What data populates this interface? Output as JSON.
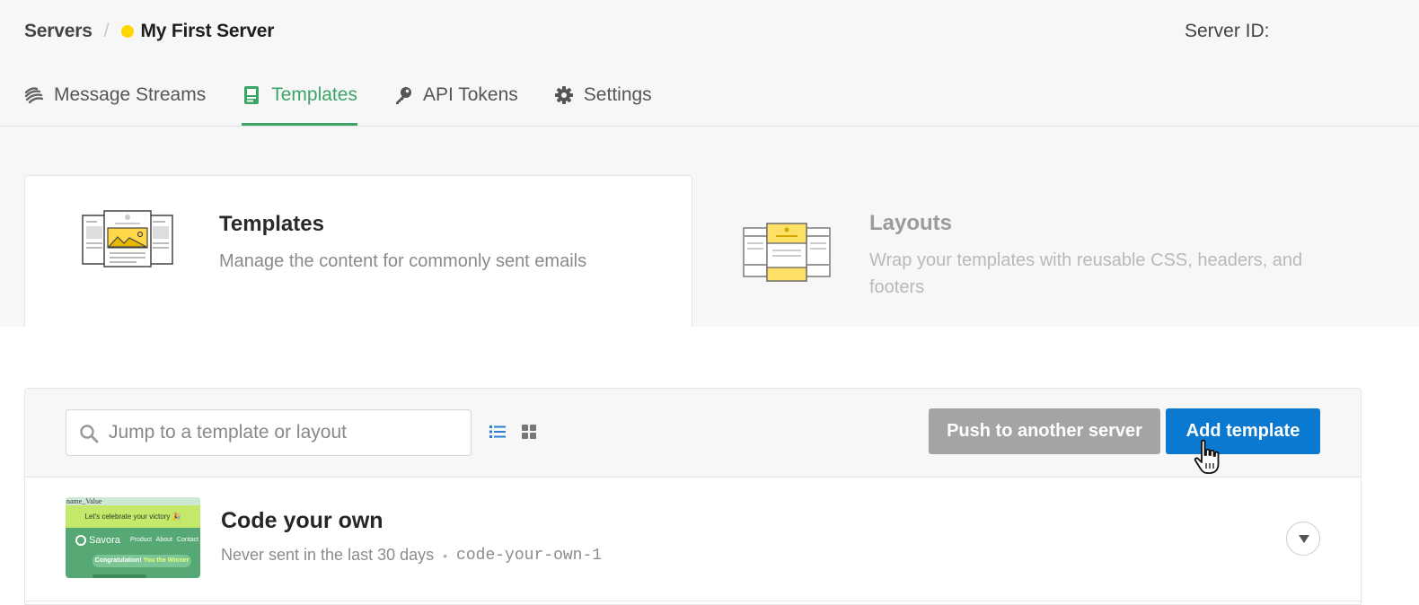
{
  "breadcrumb": {
    "parent": "Servers",
    "separator": "/",
    "current": "My First Server",
    "status_color": "#ffd700"
  },
  "server_id_label": "Server ID:",
  "nav": {
    "tabs": [
      {
        "label": "Message Streams",
        "icon": "message-streams-icon",
        "active": false
      },
      {
        "label": "Templates",
        "icon": "template-icon",
        "active": true
      },
      {
        "label": "API Tokens",
        "icon": "key-icon",
        "active": false
      },
      {
        "label": "Settings",
        "icon": "gear-icon",
        "active": false
      }
    ],
    "active_color": "#3aa566"
  },
  "cards": {
    "templates": {
      "title": "Templates",
      "description": "Manage the content for commonly sent emails"
    },
    "layouts": {
      "title": "Layouts",
      "description": "Wrap your templates with reusable CSS, headers, and footers"
    }
  },
  "toolbar": {
    "search_placeholder": "Jump to a template or layout",
    "list_view_icon": "list-view-icon",
    "grid_view_icon": "grid-view-icon",
    "push_label": "Push to another server",
    "add_label": "Add template",
    "add_color": "#0b79d0"
  },
  "templates": [
    {
      "name": "Code your own",
      "activity": "Never sent in the last 30 days",
      "alias": "code-your-own-1",
      "thumbnail": {
        "top_text": "name_Value",
        "banner": "Let's celebrate your victory 🎉",
        "brand": "Savora",
        "nav": "Product About Contact",
        "pill_text": "Congratulation!",
        "pill_highlight": "You the Winner"
      }
    }
  ]
}
